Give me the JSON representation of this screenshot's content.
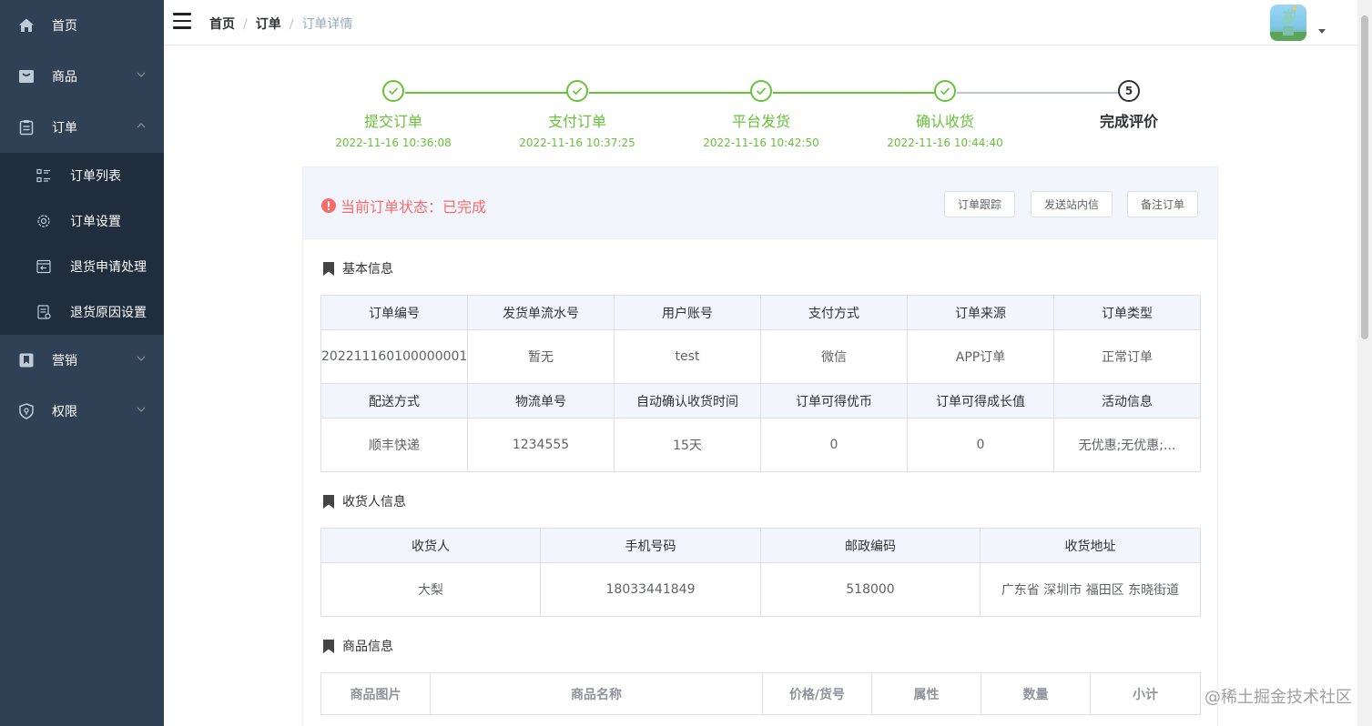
{
  "sidebar": {
    "items": [
      {
        "label": "首页",
        "icon": "home-icon"
      },
      {
        "label": "商品",
        "icon": "bag-icon"
      },
      {
        "label": "订单",
        "icon": "clipboard-icon"
      }
    ],
    "submenu": [
      {
        "label": "订单列表",
        "icon": "list-icon"
      },
      {
        "label": "订单设置",
        "icon": "gear-icon"
      },
      {
        "label": "退货申请处理",
        "icon": "return-icon"
      },
      {
        "label": "退货原因设置",
        "icon": "document-icon"
      }
    ],
    "items_after": [
      {
        "label": "营销",
        "icon": "bookmark-icon"
      },
      {
        "label": "权限",
        "icon": "shield-icon"
      }
    ]
  },
  "breadcrumb": [
    "首页",
    "订单",
    "订单详情"
  ],
  "steps": [
    {
      "title": "提交订单",
      "time": "2022-11-16 10:36:08",
      "status": "done"
    },
    {
      "title": "支付订单",
      "time": "2022-11-16 10:37:25",
      "status": "done"
    },
    {
      "title": "平台发货",
      "time": "2022-11-16 10:42:50",
      "status": "done"
    },
    {
      "title": "确认收货",
      "time": "2022-11-16 10:44:40",
      "status": "done"
    },
    {
      "title": "完成评价",
      "number": "5",
      "status": "active"
    }
  ],
  "order_status": "当前订单状态：已完成",
  "buttons": {
    "track": "订单跟踪",
    "message": "发送站内信",
    "remark": "备注订单"
  },
  "basic": {
    "title": "基本信息",
    "headers1": [
      "订单编号",
      "发货单流水号",
      "用户账号",
      "支付方式",
      "订单来源",
      "订单类型"
    ],
    "values1": [
      "202211160100000001",
      "暂无",
      "test",
      "微信",
      "APP订单",
      "正常订单"
    ],
    "headers2": [
      "配送方式",
      "物流单号",
      "自动确认收货时间",
      "订单可得优币",
      "订单可得成长值",
      "活动信息"
    ],
    "values2": [
      "顺丰快递",
      "1234555",
      "15天",
      "0",
      "0",
      "无优惠;无优惠;..."
    ]
  },
  "receiver": {
    "title": "收货人信息",
    "headers": [
      "收货人",
      "手机号码",
      "邮政编码",
      "收货地址"
    ],
    "values": [
      "大梨",
      "18033441849",
      "518000",
      "广东省 深圳市 福田区 东晓街道"
    ]
  },
  "goods": {
    "title": "商品信息",
    "headers": [
      "商品图片",
      "商品名称",
      "价格/货号",
      "属性",
      "数量",
      "小计"
    ]
  },
  "watermark": "@稀土掘金技术社区",
  "colors": {
    "sidebar": "#304156",
    "submenu": "#1f2d3d",
    "success": "#67c23a",
    "danger": "#f56c6c"
  }
}
